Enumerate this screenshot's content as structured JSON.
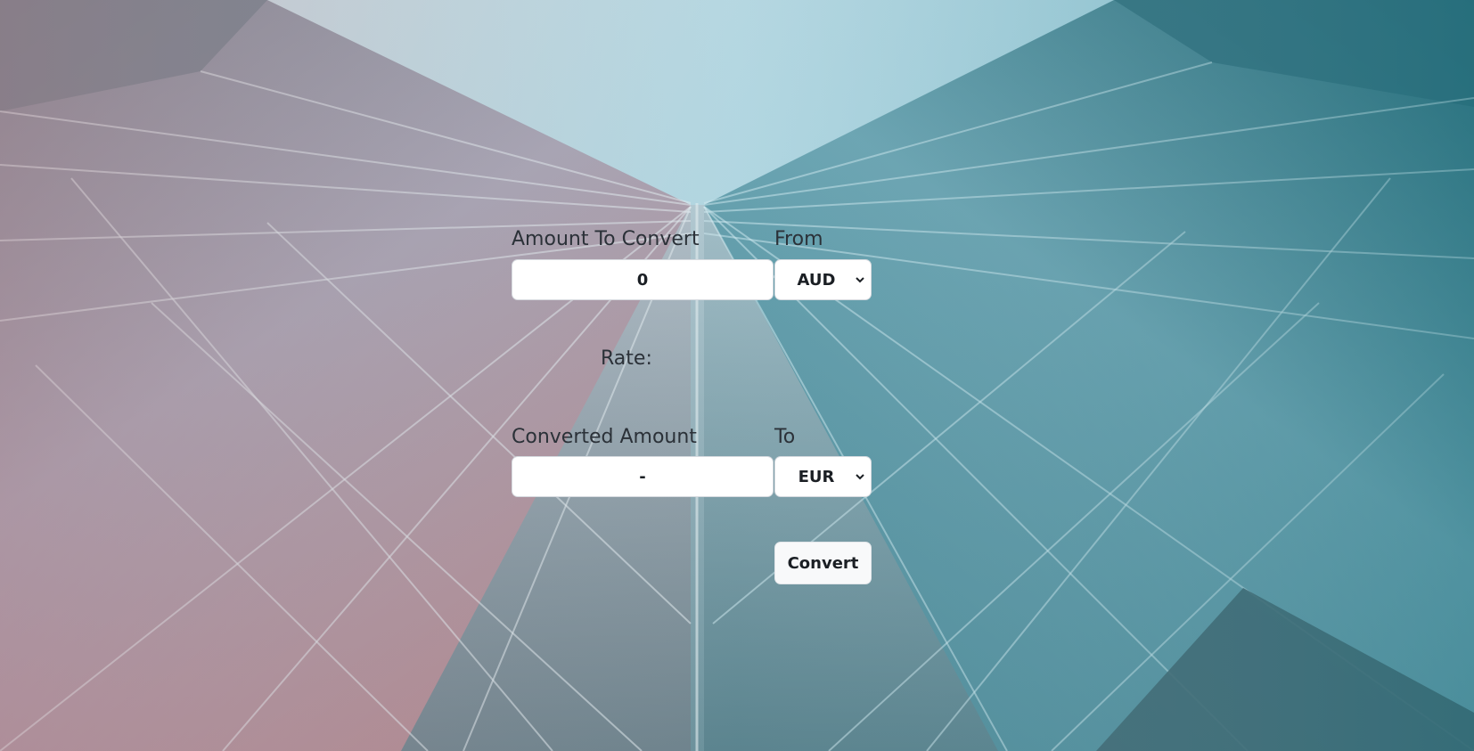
{
  "converter": {
    "amount_label": "Amount To Convert",
    "amount_value": "0",
    "from_label": "From",
    "from_currency": "AUD",
    "rate_label": "Rate:",
    "converted_label": "Converted Amount",
    "converted_value": "-",
    "to_label": "To",
    "to_currency": "EUR",
    "convert_button": "Convert"
  },
  "background": {
    "sky_color": "#a9d3df",
    "left_tint": "#a07f88",
    "right_tint": "#2b7a86",
    "glass_color": "#8fb3bf"
  }
}
